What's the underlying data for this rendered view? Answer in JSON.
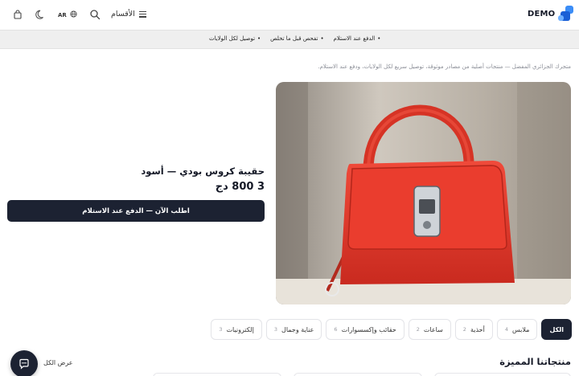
{
  "header": {
    "logo_text": "DEMO",
    "categories_label": "الأقسام",
    "lang_label": "AR",
    "icons": [
      "menu-icon",
      "search-icon",
      "globe-icon",
      "moon-icon",
      "cart-icon"
    ]
  },
  "announcement": {
    "items": [
      "الدفع عند الاستلام",
      "تفحص قبل ما تخلص",
      "توصيل لكل الولايات"
    ]
  },
  "tagline": "متجرك الجزائري المفضل — منتجات أصلية من مصادر موثوقة، توصيل سريع لكل الولايات، ودفع عند الاستلام.",
  "hero": {
    "product_title": "حقيبة كروس بودي — أسود",
    "price": "3 800 دج",
    "order_button": "اطلب الآن — الدفع عند الاستلام",
    "colors": {
      "bag": "#e0392b",
      "background": "#b9b1a6"
    }
  },
  "categories": [
    {
      "label": "الكل",
      "count": "",
      "active": true
    },
    {
      "label": "ملابس",
      "count": "4",
      "active": false
    },
    {
      "label": "أحذية",
      "count": "2",
      "active": false
    },
    {
      "label": "ساعات",
      "count": "2",
      "active": false
    },
    {
      "label": "حقائب وإكسسوارات",
      "count": "6",
      "active": false
    },
    {
      "label": "عناية وجمال",
      "count": "3",
      "active": false
    },
    {
      "label": "إلكترونيات",
      "count": "3",
      "active": false
    }
  ],
  "featured": {
    "title": "منتجاتنا المميزة",
    "view_all": "عرض الكل"
  },
  "colors": {
    "primary": "#1c2232",
    "accent": "#1a5fd6",
    "announce_bg": "#efefef"
  }
}
